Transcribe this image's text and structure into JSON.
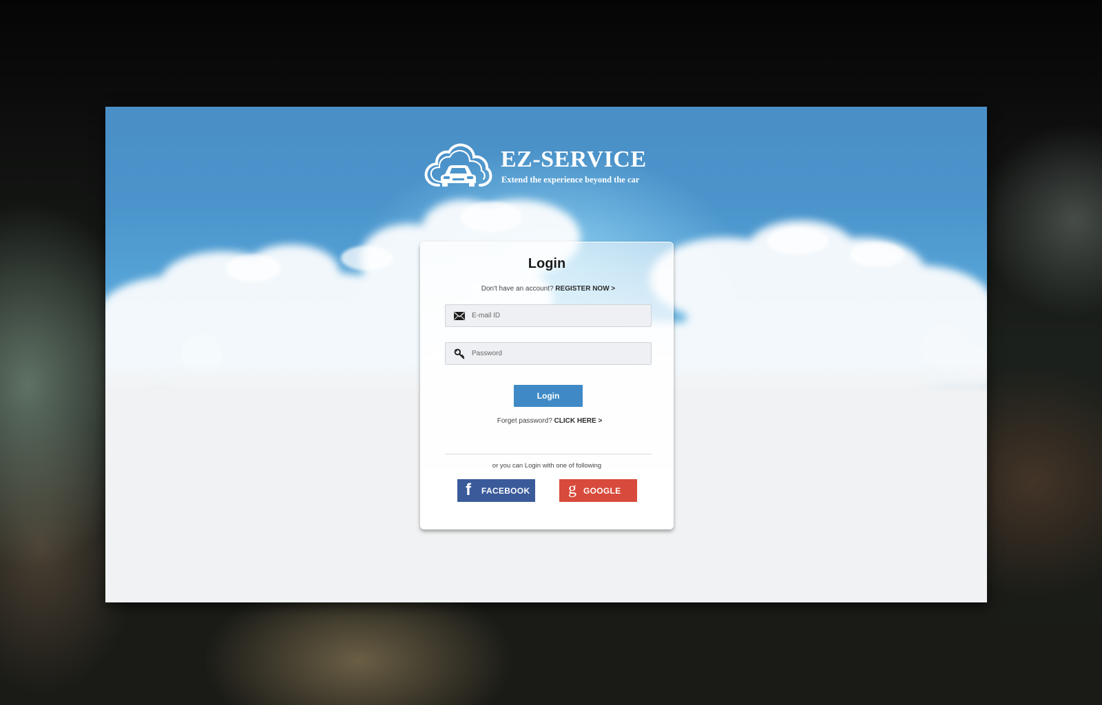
{
  "brand": {
    "name": "EZ-SERVICE",
    "tagline": "Extend the experience beyond the car",
    "logo_icon": "cloud-car-icon"
  },
  "login": {
    "title": "Login",
    "register_prompt": "Don't have an account?",
    "register_link": "REGISTER NOW >",
    "email": {
      "placeholder": "E-mail ID",
      "value": "",
      "icon": "envelope-icon"
    },
    "password": {
      "placeholder": "Password",
      "value": "",
      "icon": "key-icon"
    },
    "submit_label": "Login",
    "forgot_prompt": "Forget password?",
    "forgot_link": "CLICK HERE >",
    "social_prompt": "or you can Login with one of following",
    "social": {
      "facebook": {
        "glyph": "f",
        "label": "FACEBOOK",
        "icon": "facebook-icon",
        "color": "#3a5a9a"
      },
      "google": {
        "glyph": "g",
        "label": "GOOGLE",
        "icon": "google-icon",
        "color": "#d84a3b"
      }
    }
  },
  "colors": {
    "sky": "#4b95cc",
    "primary_button": "#3f8ac6",
    "page_background": "#f1f2f3"
  }
}
